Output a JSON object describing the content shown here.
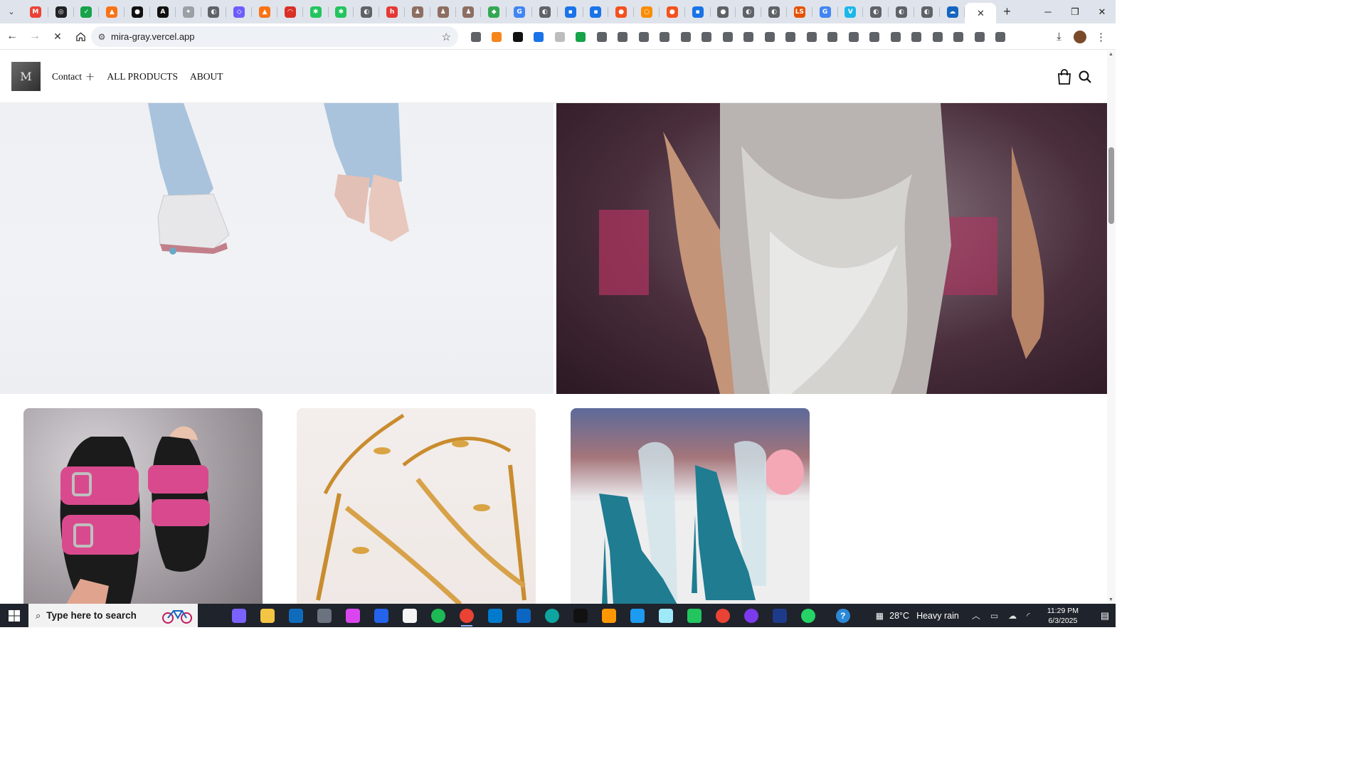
{
  "browser": {
    "tabs": [
      {
        "icon": "chevron-down-icon"
      },
      {
        "icon": "gmail-icon",
        "color": "#ea4335",
        "glyph": "M"
      },
      {
        "icon": "circle-app-icon",
        "color": "#202124",
        "glyph": "◎"
      },
      {
        "icon": "grammar-app-icon",
        "color": "#16a34a",
        "glyph": "✓"
      },
      {
        "icon": "flame-icon",
        "color": "#f97316",
        "glyph": "▲"
      },
      {
        "icon": "github-icon",
        "color": "#111111",
        "glyph": "●"
      },
      {
        "icon": "a-app-icon",
        "color": "#111111",
        "glyph": "A"
      },
      {
        "icon": "chat-app-icon",
        "color": "#9aa0a6",
        "glyph": "✦"
      },
      {
        "icon": "globe-icon",
        "color": "#5f6368",
        "glyph": "◐"
      },
      {
        "icon": "shield-icon",
        "color": "#6d5dfc",
        "glyph": "◇"
      },
      {
        "icon": "flame-icon",
        "color": "#f97316",
        "glyph": "▲"
      },
      {
        "icon": "gauge-icon",
        "color": "#d93025",
        "glyph": "◠"
      },
      {
        "icon": "asterisk-icon",
        "color": "#22c55e",
        "glyph": "✱"
      },
      {
        "icon": "asterisk-icon",
        "color": "#22c55e",
        "glyph": "✱"
      },
      {
        "icon": "globe-icon",
        "color": "#5f6368",
        "glyph": "◐"
      },
      {
        "icon": "h-app-icon",
        "color": "#e53935",
        "glyph": "h"
      },
      {
        "icon": "person-app-icon",
        "color": "#8d6e63",
        "glyph": "♟"
      },
      {
        "icon": "person-app-icon",
        "color": "#8d6e63",
        "glyph": "♟"
      },
      {
        "icon": "person-app-icon",
        "color": "#8d6e63",
        "glyph": "♟"
      },
      {
        "icon": "maps-icon",
        "color": "#34a853",
        "glyph": "⬥"
      },
      {
        "icon": "google-icon",
        "color": "#4285f4",
        "glyph": "G"
      },
      {
        "icon": "globe-icon",
        "color": "#5f6368",
        "glyph": "◐"
      },
      {
        "icon": "blue-app-icon",
        "color": "#1a73e8",
        "glyph": "▪"
      },
      {
        "icon": "blue-app-icon",
        "color": "#1a73e8",
        "glyph": "▪"
      },
      {
        "icon": "orange-app-icon",
        "color": "#f4511e",
        "glyph": "●"
      },
      {
        "icon": "orange-app-icon",
        "color": "#fb8c00",
        "glyph": "○"
      },
      {
        "icon": "orange-app-icon",
        "color": "#f4511e",
        "glyph": "●"
      },
      {
        "icon": "blue-app-icon",
        "color": "#1a73e8",
        "glyph": "▪"
      },
      {
        "icon": "key-app-icon",
        "color": "#5f6368",
        "glyph": "●"
      },
      {
        "icon": "globe-icon",
        "color": "#5f6368",
        "glyph": "◐"
      },
      {
        "icon": "globe-icon",
        "color": "#5f6368",
        "glyph": "◐"
      },
      {
        "icon": "ls-app-icon",
        "color": "#e65100",
        "glyph": "LS"
      },
      {
        "icon": "google-icon",
        "color": "#4285f4",
        "glyph": "G"
      },
      {
        "icon": "v-app-icon",
        "color": "#1ab7ea",
        "glyph": "V"
      },
      {
        "icon": "globe-icon",
        "color": "#5f6368",
        "glyph": "◐"
      },
      {
        "icon": "globe-icon",
        "color": "#5f6368",
        "glyph": "◐"
      },
      {
        "icon": "globe-icon",
        "color": "#5f6368",
        "glyph": "◐"
      },
      {
        "icon": "cloud-app-icon",
        "color": "#1565c0",
        "glyph": "☁"
      }
    ],
    "active_tab_close": "✕",
    "new_tab": "+",
    "window_controls": {
      "minimize": "─",
      "restore": "❐",
      "close": "✕"
    },
    "address": {
      "url": "mira-gray.vercel.app"
    },
    "extension_colors": [
      "#5f6368",
      "#f6851b",
      "#111111",
      "#1a73e8",
      "#bdbdbd",
      "#16a34a",
      "#5f6368",
      "#5f6368",
      "#5f6368",
      "#5f6368",
      "#5f6368",
      "#5f6368",
      "#5f6368",
      "#5f6368",
      "#5f6368",
      "#5f6368",
      "#5f6368",
      "#5f6368",
      "#5f6368",
      "#5f6368",
      "#5f6368",
      "#5f6368",
      "#5f6368",
      "#5f6368",
      "#5f6368",
      "#5f6368"
    ]
  },
  "site": {
    "logo_mark": "M",
    "nav": {
      "contact": "Contact",
      "all_products": "ALL PRODUCTS",
      "about": "ABOUT"
    },
    "accent": "#111111"
  },
  "taskbar": {
    "search_placeholder": "Type here to search",
    "apps": [
      {
        "icon": "copilot-icon",
        "color": "#7b61ff"
      },
      {
        "icon": "file-explorer-icon",
        "color": "#f4c542"
      },
      {
        "icon": "outlook-icon",
        "color": "#0f6cbd"
      },
      {
        "icon": "camera-icon",
        "color": "#6b7280"
      },
      {
        "icon": "m365-icon",
        "color": "#d946ef"
      },
      {
        "icon": "store-icon",
        "color": "#2563eb"
      },
      {
        "icon": "capcut-icon",
        "color": "#f5f5f5"
      },
      {
        "icon": "spotify-icon",
        "color": "#1db954"
      },
      {
        "icon": "chrome-icon",
        "color": "#ea4335"
      },
      {
        "icon": "vscode-icon",
        "color": "#007acc"
      },
      {
        "icon": "linkedin-icon",
        "color": "#0a66c2"
      },
      {
        "icon": "edge-icon",
        "color": "#0ea5a0"
      },
      {
        "icon": "tiktok-icon",
        "color": "#111111"
      },
      {
        "icon": "sublime-icon",
        "color": "#ff9800"
      },
      {
        "icon": "twitter-icon",
        "color": "#1d9bf0"
      },
      {
        "icon": "electron-icon",
        "color": "#9feaf9"
      },
      {
        "icon": "play-icon",
        "color": "#22c55e"
      },
      {
        "icon": "chrome-badge-icon",
        "color": "#ea4335"
      },
      {
        "icon": "media-player-icon",
        "color": "#7c3aed"
      },
      {
        "icon": "f-app-icon",
        "color": "#1e3a8a"
      },
      {
        "icon": "whatsapp-icon",
        "color": "#25d366"
      }
    ],
    "weather": {
      "temp": "28°C",
      "condition": "Heavy rain"
    },
    "clock": {
      "time": "11:29 PM",
      "date": "6/3/2025"
    }
  }
}
